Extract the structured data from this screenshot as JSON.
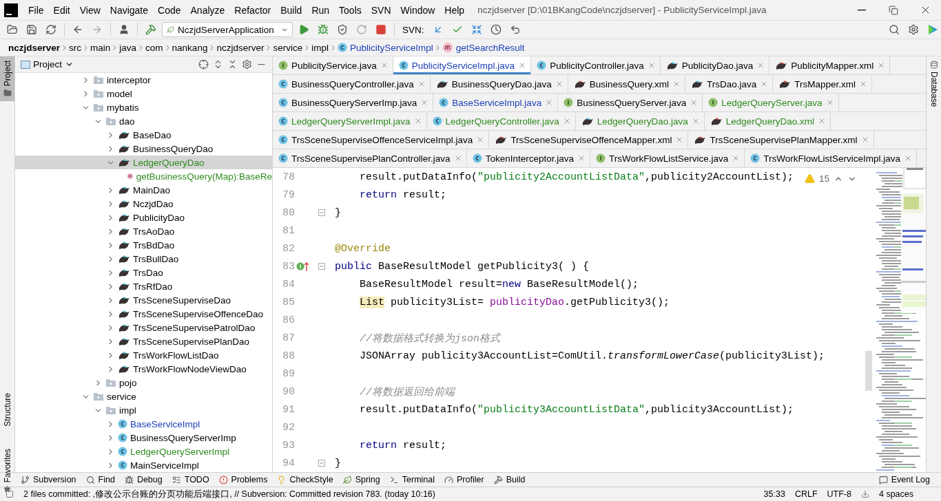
{
  "window": {
    "title": "nczjdserver [D:\\01BKangCode\\nczjdserver] - PublicityServiceImpl.java"
  },
  "menu": [
    "File",
    "Edit",
    "View",
    "Navigate",
    "Code",
    "Analyze",
    "Refactor",
    "Build",
    "Run",
    "Tools",
    "SVN",
    "Window",
    "Help"
  ],
  "toolbar": {
    "run_config": "NczjdServerApplication",
    "svn_label": "SVN:"
  },
  "breadcrumb": [
    {
      "label": "nczjdserver",
      "kind": "root"
    },
    {
      "label": "src",
      "kind": "dir"
    },
    {
      "label": "main",
      "kind": "dir"
    },
    {
      "label": "java",
      "kind": "dir"
    },
    {
      "label": "com",
      "kind": "dir"
    },
    {
      "label": "nankang",
      "kind": "dir"
    },
    {
      "label": "nczjdserver",
      "kind": "dir"
    },
    {
      "label": "service",
      "kind": "dir"
    },
    {
      "label": "impl",
      "kind": "dir"
    },
    {
      "label": "PublicityServiceImpl",
      "kind": "class"
    },
    {
      "label": "getSearchResult",
      "kind": "method"
    }
  ],
  "left_strip": [
    {
      "label": "Project",
      "selected": true
    },
    {
      "label": "Structure",
      "selected": false
    },
    {
      "label": "Favorites",
      "selected": false
    }
  ],
  "project": {
    "title": "Project",
    "tree": [
      {
        "label": "interceptor",
        "kind": "package",
        "color": "#000000",
        "selected": false,
        "expanded": false
      },
      {
        "label": "model",
        "kind": "package",
        "color": "#000000",
        "selected": false,
        "expanded": false
      },
      {
        "label": "mybatis",
        "kind": "package",
        "color": "#000000",
        "selected": false,
        "expanded": true,
        "children": [
          {
            "label": "dao",
            "kind": "package",
            "color": "#000000",
            "selected": false,
            "expanded": true,
            "children": [
              {
                "label": "BaseDao",
                "kind": "mapper",
                "color": "#000000",
                "selected": false,
                "expanded": false
              },
              {
                "label": "BusinessQueryDao",
                "kind": "mapper",
                "color": "#000000",
                "selected": false,
                "expanded": false
              },
              {
                "label": "LedgerQueryDao",
                "kind": "mapper",
                "color": "#2f8a1f",
                "selected": true,
                "expanded": true,
                "children": [
                  {
                    "label": "getBusinessQuery(Map):BaseRe",
                    "kind": "method",
                    "color": "#2f8a1f",
                    "selected": false
                  }
                ]
              },
              {
                "label": "MainDao",
                "kind": "mapper",
                "color": "#000000",
                "selected": false,
                "expanded": false
              },
              {
                "label": "NczjdDao",
                "kind": "mapper",
                "color": "#000000",
                "selected": false,
                "expanded": false
              },
              {
                "label": "PublicityDao",
                "kind": "mapper",
                "color": "#000000",
                "selected": false,
                "expanded": false
              },
              {
                "label": "TrsAoDao",
                "kind": "mapper",
                "color": "#000000",
                "selected": false,
                "expanded": false
              },
              {
                "label": "TrsBdDao",
                "kind": "mapper",
                "color": "#000000",
                "selected": false,
                "expanded": false
              },
              {
                "label": "TrsBullDao",
                "kind": "mapper",
                "color": "#000000",
                "selected": false,
                "expanded": false
              },
              {
                "label": "TrsDao",
                "kind": "mapper",
                "color": "#000000",
                "selected": false,
                "expanded": false
              },
              {
                "label": "TrsRfDao",
                "kind": "mapper",
                "color": "#000000",
                "selected": false,
                "expanded": false
              },
              {
                "label": "TrsSceneSuperviseDao",
                "kind": "mapper",
                "color": "#000000",
                "selected": false,
                "expanded": false
              },
              {
                "label": "TrsSceneSuperviseOffenceDao",
                "kind": "mapper",
                "color": "#000000",
                "selected": false,
                "expanded": false
              },
              {
                "label": "TrsSceneSupervisePatrolDao",
                "kind": "mapper",
                "color": "#000000",
                "selected": false,
                "expanded": false
              },
              {
                "label": "TrsSceneSupervisePlanDao",
                "kind": "mapper",
                "color": "#000000",
                "selected": false,
                "expanded": false
              },
              {
                "label": "TrsWorkFlowListDao",
                "kind": "mapper",
                "color": "#000000",
                "selected": false,
                "expanded": false
              },
              {
                "label": "TrsWorkFlowNodeViewDao",
                "kind": "mapper",
                "color": "#000000",
                "selected": false,
                "expanded": false
              }
            ]
          },
          {
            "label": "pojo",
            "kind": "package",
            "color": "#000000",
            "selected": false,
            "expanded": false
          }
        ]
      },
      {
        "label": "service",
        "kind": "package",
        "color": "#000000",
        "selected": false,
        "expanded": true,
        "children": [
          {
            "label": "impl",
            "kind": "package",
            "color": "#000000",
            "selected": false,
            "expanded": true,
            "children": [
              {
                "label": "BaseServiceImpl",
                "kind": "class",
                "color": "#1c3fb5",
                "selected": false,
                "expanded": false
              },
              {
                "label": "BusinessQueryServerImp",
                "kind": "class",
                "color": "#000000",
                "selected": false,
                "expanded": false
              },
              {
                "label": "LedgerQueryServerImpl",
                "kind": "class",
                "color": "#2f8a1f",
                "selected": false,
                "expanded": false
              },
              {
                "label": "MainServiceImpl",
                "kind": "class",
                "color": "#000000",
                "selected": false,
                "expanded": false
              }
            ]
          }
        ]
      }
    ]
  },
  "editor": {
    "tab_rows": [
      [
        {
          "label": "PublicityService.java",
          "kind": "interface",
          "color": "#000000",
          "selected": false
        },
        {
          "label": "PublicityServiceImpl.java",
          "kind": "class",
          "color": "#1c3fb5",
          "selected": true
        },
        {
          "label": "PublicityController.java",
          "kind": "class",
          "color": "#000000",
          "selected": false
        },
        {
          "label": "PublicityDao.java",
          "kind": "mapper",
          "color": "#000000",
          "selected": false
        },
        {
          "label": "PublicityMapper.xml",
          "kind": "xml",
          "color": "#000000",
          "selected": false
        }
      ],
      [
        {
          "label": "BusinessQueryController.java",
          "kind": "class",
          "color": "#000000",
          "selected": false
        },
        {
          "label": "BusinessQueryDao.java",
          "kind": "mapper",
          "color": "#000000",
          "selected": false
        },
        {
          "label": "BusinessQuery.xml",
          "kind": "xml",
          "color": "#000000",
          "selected": false
        },
        {
          "label": "TrsDao.java",
          "kind": "mapper",
          "color": "#000000",
          "selected": false
        },
        {
          "label": "TrsMapper.xml",
          "kind": "xml",
          "color": "#000000",
          "selected": false
        }
      ],
      [
        {
          "label": "BusinessQueryServerImp.java",
          "kind": "class",
          "color": "#000000",
          "selected": false
        },
        {
          "label": "BaseServiceImpl.java",
          "kind": "class",
          "color": "#1c3fb5",
          "selected": false
        },
        {
          "label": "BusinessQueryServer.java",
          "kind": "interface",
          "color": "#000000",
          "selected": false
        },
        {
          "label": "LedgerQueryServer.java",
          "kind": "interface",
          "color": "#2f8a1f",
          "selected": false
        }
      ],
      [
        {
          "label": "LedgerQueryServerImpl.java",
          "kind": "class",
          "color": "#2f8a1f",
          "selected": false
        },
        {
          "label": "LedgerQueryController.java",
          "kind": "class",
          "color": "#2f8a1f",
          "selected": false
        },
        {
          "label": "LedgerQueryDao.java",
          "kind": "mapper",
          "color": "#2f8a1f",
          "selected": false
        },
        {
          "label": "LedgerQueryDao.xml",
          "kind": "xml",
          "color": "#2f8a1f",
          "selected": false
        }
      ],
      [
        {
          "label": "TrsSceneSuperviseOffenceServiceImpl.java",
          "kind": "class",
          "color": "#000000",
          "selected": false
        },
        {
          "label": "TrsSceneSuperviseOffenceMapper.xml",
          "kind": "xml",
          "color": "#000000",
          "selected": false
        },
        {
          "label": "TrsSceneSupervisePlanMapper.xml",
          "kind": "xml",
          "color": "#000000",
          "selected": false
        }
      ],
      [
        {
          "label": "TrsSceneSupervisePlanController.java",
          "kind": "class",
          "color": "#000000",
          "selected": false
        },
        {
          "label": "TokenInterceptor.java",
          "kind": "class",
          "color": "#000000",
          "selected": false
        },
        {
          "label": "TrsWorkFlowListService.java",
          "kind": "interface",
          "color": "#000000",
          "selected": false
        },
        {
          "label": "TrsWorkFlowListServiceImpl.java",
          "kind": "class",
          "color": "#000000",
          "selected": false
        }
      ]
    ],
    "lines": [
      {
        "number": "78",
        "inner": true,
        "fold": false,
        "implements": false,
        "tokens": [
          {
            "text": "result.putDataInfo(",
            "kind": "plain"
          },
          {
            "text": "\"publicity2AccountListData\"",
            "kind": "string"
          },
          {
            "text": ",publicity2AccountList);",
            "kind": "plain"
          }
        ]
      },
      {
        "number": "79",
        "inner": true,
        "fold": false,
        "implements": false,
        "tokens": [
          {
            "text": "return",
            "kind": "keyword"
          },
          {
            "text": " result;",
            "kind": "plain"
          }
        ]
      },
      {
        "number": "80",
        "inner": false,
        "fold": true,
        "implements": false,
        "tokens": [
          {
            "text": "}",
            "kind": "plain"
          }
        ]
      },
      {
        "number": "81",
        "fold": false,
        "implements": false
      },
      {
        "number": "82",
        "inner": false,
        "fold": false,
        "implements": false,
        "tokens": [
          {
            "text": "@Override",
            "kind": "annotation"
          }
        ]
      },
      {
        "number": "83",
        "inner": false,
        "fold": true,
        "implements": true,
        "tokens": [
          {
            "text": "public",
            "kind": "keyword"
          },
          {
            "text": " BaseResultModel getPublicity3( ) {",
            "kind": "plain"
          }
        ]
      },
      {
        "number": "84",
        "inner": true,
        "fold": false,
        "implements": false,
        "tokens": [
          {
            "text": "BaseResultModel result=",
            "kind": "plain"
          },
          {
            "text": "new",
            "kind": "keyword"
          },
          {
            "text": " BaseResultModel();",
            "kind": "plain"
          }
        ]
      },
      {
        "number": "85",
        "inner": true,
        "fold": false,
        "implements": false,
        "tokens": [
          {
            "text": "List",
            "kind": "warning"
          },
          {
            "text": " publicity3List= ",
            "kind": "plain"
          },
          {
            "text": "publicityDao",
            "kind": "field"
          },
          {
            "text": ".getPublicity3();",
            "kind": "plain"
          }
        ]
      },
      {
        "number": "86",
        "fold": false,
        "implements": false
      },
      {
        "number": "87",
        "inner": true,
        "fold": false,
        "implements": false,
        "tokens": [
          {
            "text": "//将数据格式转换为json格式",
            "kind": "comment"
          }
        ]
      },
      {
        "number": "88",
        "inner": true,
        "fold": false,
        "implements": false,
        "tokens": [
          {
            "text": "JSONArray publicity3AccountList=ComUtil.",
            "kind": "plain"
          },
          {
            "text": "transformLowerCase",
            "kind": "static"
          },
          {
            "text": "(publicity3List);",
            "kind": "plain"
          }
        ]
      },
      {
        "number": "89",
        "fold": false,
        "implements": false
      },
      {
        "number": "90",
        "inner": true,
        "fold": false,
        "implements": false,
        "tokens": [
          {
            "text": "//将数据返回给前端",
            "kind": "comment"
          }
        ]
      },
      {
        "number": "91",
        "inner": true,
        "fold": false,
        "implements": false,
        "tokens": [
          {
            "text": "result.putDataInfo(",
            "kind": "plain"
          },
          {
            "text": "\"publicity3AccountListData\"",
            "kind": "string"
          },
          {
            "text": ",publicity3AccountList);",
            "kind": "plain"
          }
        ]
      },
      {
        "number": "92",
        "fold": false,
        "implements": false
      },
      {
        "number": "93",
        "inner": true,
        "fold": false,
        "implements": false,
        "tokens": [
          {
            "text": "return",
            "kind": "keyword"
          },
          {
            "text": " result;",
            "kind": "plain"
          }
        ]
      },
      {
        "number": "94",
        "inner": false,
        "fold": true,
        "implements": false,
        "tokens": [
          {
            "text": "}",
            "kind": "plain"
          }
        ]
      }
    ],
    "warning_count": "15"
  },
  "right_strip": [
    {
      "label": "Database"
    }
  ],
  "tool_windows": [
    {
      "label": "Subversion",
      "kind": "vcs"
    },
    {
      "label": "Find",
      "kind": "find"
    },
    {
      "label": "Debug",
      "kind": "debug"
    },
    {
      "label": "TODO",
      "kind": "todo"
    },
    {
      "label": "Problems",
      "kind": "problems"
    },
    {
      "label": "CheckStyle",
      "kind": "checkstyle"
    },
    {
      "label": "Spring",
      "kind": "spring"
    },
    {
      "label": "Terminal",
      "kind": "terminal"
    },
    {
      "label": "Profiler",
      "kind": "profiler"
    },
    {
      "label": "Build",
      "kind": "build"
    }
  ],
  "event_log": "Event Log",
  "status_bar": {
    "message": "2 files committed: ,修改公示台账的分页功能后端接口, // Subversion: Committed revision 783. (today 10:16)",
    "position": "35:33",
    "line_ending": "CRLF",
    "encoding": "UTF-8",
    "indent": "4 spaces"
  }
}
